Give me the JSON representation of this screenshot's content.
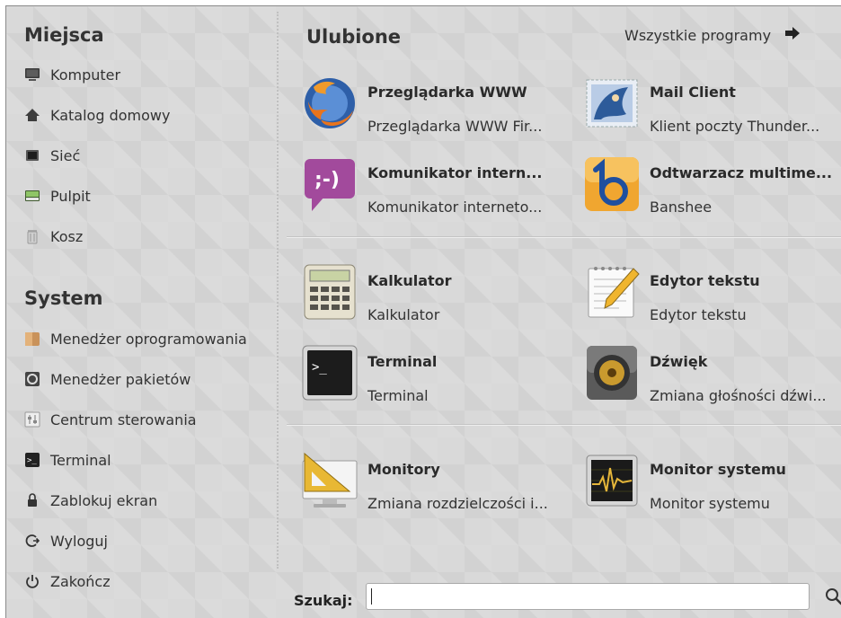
{
  "places": {
    "title": "Miejsca",
    "items": [
      {
        "label": "Komputer",
        "icon": "computer-icon"
      },
      {
        "label": "Katalog domowy",
        "icon": "home-icon"
      },
      {
        "label": "Sieć",
        "icon": "network-icon"
      },
      {
        "label": "Pulpit",
        "icon": "desktop-icon"
      },
      {
        "label": "Kosz",
        "icon": "trash-icon"
      }
    ]
  },
  "system": {
    "title": "System",
    "items": [
      {
        "label": "Menedżer oprogramowania",
        "icon": "software-manager-icon"
      },
      {
        "label": "Menedżer pakietów",
        "icon": "package-manager-icon"
      },
      {
        "label": "Centrum sterowania",
        "icon": "control-center-icon"
      },
      {
        "label": "Terminal",
        "icon": "terminal-icon"
      },
      {
        "label": "Zablokuj ekran",
        "icon": "lock-icon"
      },
      {
        "label": "Wyloguj",
        "icon": "logout-icon"
      },
      {
        "label": "Zakończ",
        "icon": "power-icon"
      }
    ]
  },
  "favorites": {
    "title": "Ulubione",
    "all_programs": "Wszystkie programy",
    "apps": [
      {
        "name": "Przeglądarka WWW",
        "desc": "Przeglądarka WWW Fir...",
        "icon": "firefox-icon"
      },
      {
        "name": "Mail Client",
        "desc": "Klient poczty Thunder...",
        "icon": "thunderbird-icon"
      },
      {
        "name": "Komunikator intern...",
        "desc": "Komunikator interneto...",
        "icon": "messenger-icon"
      },
      {
        "name": "Odtwarzacz multime...",
        "desc": "Banshee",
        "icon": "banshee-icon"
      },
      {
        "name": "Kalkulator",
        "desc": "Kalkulator",
        "icon": "calculator-icon"
      },
      {
        "name": "Edytor tekstu",
        "desc": "Edytor tekstu",
        "icon": "text-editor-icon"
      },
      {
        "name": "Terminal",
        "desc": "Terminal",
        "icon": "terminal-icon"
      },
      {
        "name": "Dźwięk",
        "desc": "Zmiana głośności dźwi...",
        "icon": "sound-icon"
      },
      {
        "name": "Monitory",
        "desc": "Zmiana rozdzielczości i...",
        "icon": "monitors-icon"
      },
      {
        "name": "Monitor systemu",
        "desc": "Monitor systemu",
        "icon": "system-monitor-icon"
      }
    ]
  },
  "search": {
    "label": "Szukaj:",
    "value": ""
  }
}
